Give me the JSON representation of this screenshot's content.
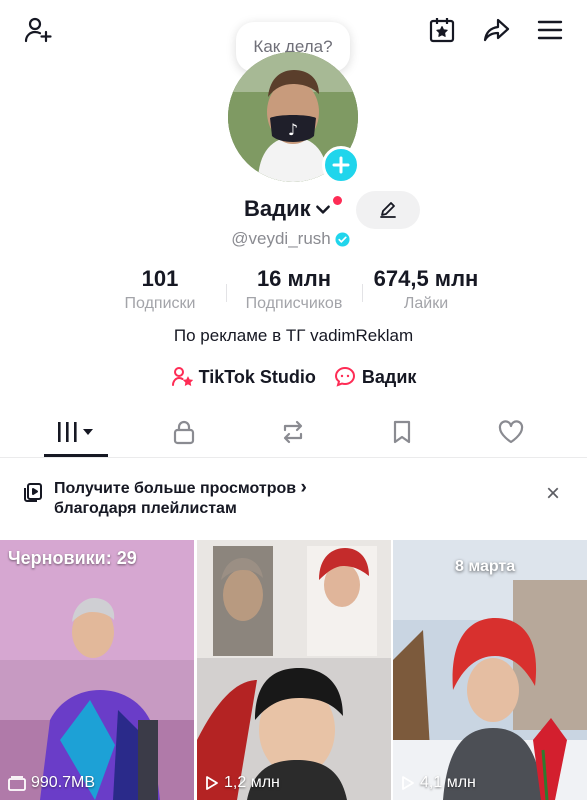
{
  "header": {
    "icons": [
      "add-user-icon",
      "calendar-star-icon",
      "share-icon",
      "menu-icon"
    ],
    "status_bubble": "Как дела?"
  },
  "profile": {
    "name": "Вадик",
    "handle": "@veydi_rush",
    "verified": true,
    "stats": [
      {
        "value": "101",
        "label": "Подписки"
      },
      {
        "value": "16 млн",
        "label": "Подписчиков"
      },
      {
        "value": "674,5 млн",
        "label": "Лайки"
      }
    ],
    "bio": "По рекламе в ТГ vadimReklam",
    "links": [
      {
        "label": "TikTok Studio",
        "icon": "studio-icon"
      },
      {
        "label": "Вадик",
        "icon": "chat-bubble-icon"
      }
    ]
  },
  "tabs": [
    {
      "name": "videos",
      "icon": "grid-bars-icon",
      "active": true
    },
    {
      "name": "private",
      "icon": "lock-icon"
    },
    {
      "name": "reposts",
      "icon": "repost-icon"
    },
    {
      "name": "saved",
      "icon": "bookmark-icon"
    },
    {
      "name": "liked",
      "icon": "heart-icon"
    }
  ],
  "banner": {
    "line1": "Получите больше просмотров",
    "line2": "благодаря плейлистам",
    "chevron": "›",
    "close": "×"
  },
  "videos": [
    {
      "top_label": "Черновики: 29",
      "bottom_label": "990.7MB",
      "icon": "drafts-icon"
    },
    {
      "bottom_label": "1,2 млн",
      "icon": "play-icon"
    },
    {
      "overlay_text": "8 марта",
      "bottom_label": "4,1 млн",
      "icon": "play-icon"
    }
  ],
  "colors": {
    "accent": "#fe2c55",
    "badge": "#20d5ec",
    "text": "#161823",
    "muted": "#a3a4a9"
  }
}
